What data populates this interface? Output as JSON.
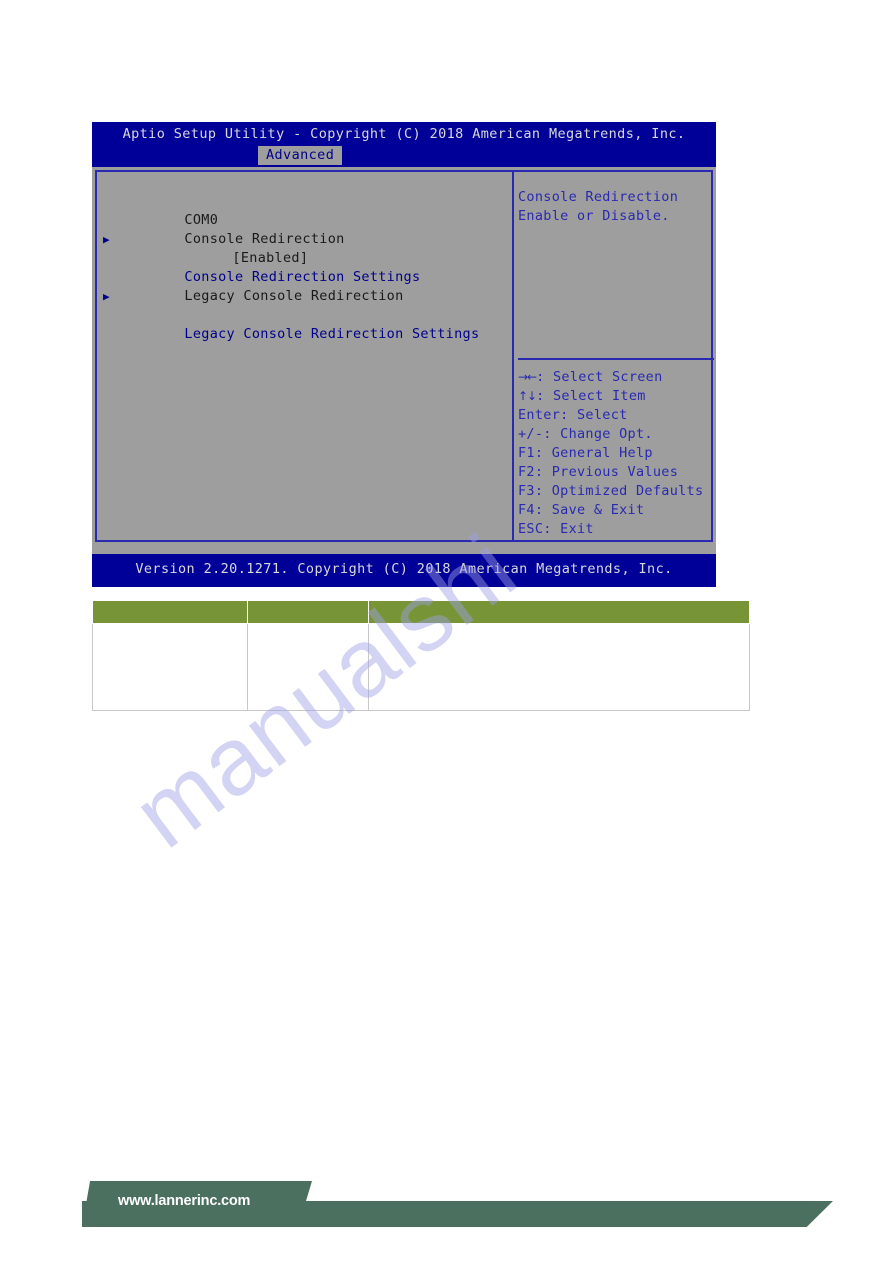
{
  "bios": {
    "title": "Aptio Setup Utility - Copyright (C) 2018 American Megatrends, Inc.",
    "active_tab": "Advanced",
    "menu": [
      {
        "type": "label",
        "text": "COM0"
      },
      {
        "type": "option",
        "text": "Console Redirection",
        "value": "[Enabled]"
      },
      {
        "type": "link",
        "text": "Console Redirection Settings"
      },
      {
        "type": "spacer",
        "text": ""
      },
      {
        "type": "label",
        "text": "Legacy Console Redirection"
      },
      {
        "type": "link",
        "text": "Legacy Console Redirection Settings"
      }
    ],
    "help": {
      "line1": "Console Redirection",
      "line2": "Enable or Disable."
    },
    "keys": [
      {
        "glyph": "→←",
        "text": ": Select Screen"
      },
      {
        "glyph": "↑↓",
        "text": ": Select Item"
      },
      {
        "glyph": "",
        "text": "Enter: Select"
      },
      {
        "glyph": "",
        "text": "+/-: Change Opt."
      },
      {
        "glyph": "",
        "text": "F1: General Help"
      },
      {
        "glyph": "",
        "text": "F2: Previous Values"
      },
      {
        "glyph": "",
        "text": "F3: Optimized Defaults"
      },
      {
        "glyph": "",
        "text": "F4: Save & Exit"
      },
      {
        "glyph": "",
        "text": "ESC: Exit"
      }
    ],
    "version": "Version 2.20.1271. Copyright (C) 2018 American Megatrends, Inc."
  },
  "table": {
    "headers": [
      "",
      "",
      ""
    ],
    "rows": [
      [
        "",
        "",
        ""
      ]
    ]
  },
  "watermark": {
    "text": "manualshi"
  },
  "footer": {
    "url": "www.lannerinc.com"
  },
  "colors": {
    "bios_blue": "#000099",
    "bios_gray": "#9e9e9e",
    "bios_text_blue": "#2a2ab0",
    "table_green": "#779537",
    "footer_green": "#4c7060"
  }
}
